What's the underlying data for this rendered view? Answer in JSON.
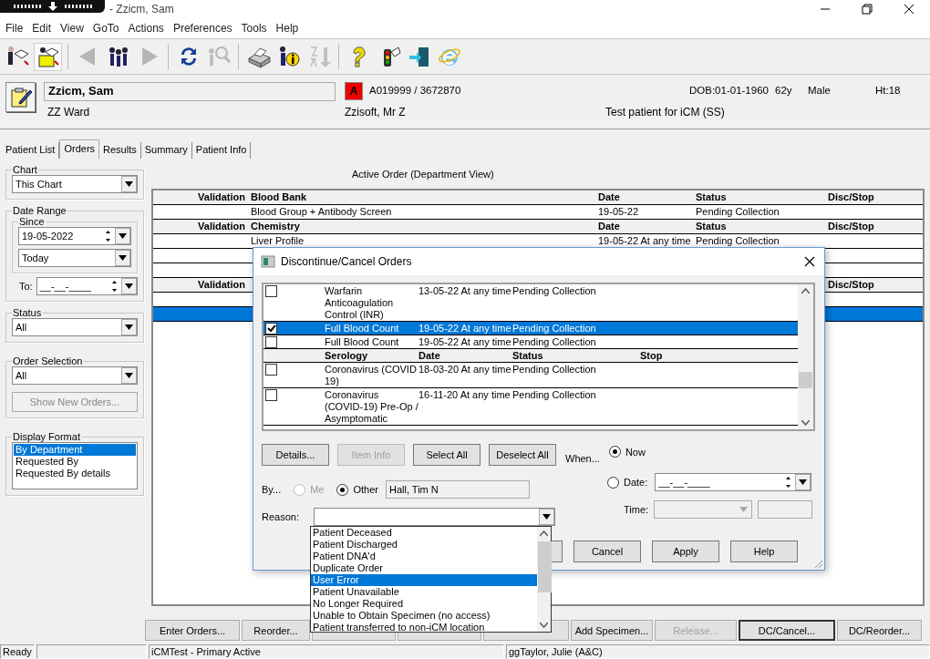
{
  "window": {
    "title": "- Zzicm, Sam"
  },
  "menu": [
    "File",
    "Edit",
    "View",
    "GoTo",
    "Actions",
    "Preferences",
    "Tools",
    "Help"
  ],
  "toolbar": [
    {
      "kind": "button",
      "disabled": false,
      "selected": false
    },
    {
      "kind": "button",
      "disabled": false,
      "selected": true
    },
    {
      "kind": "separator"
    },
    {
      "kind": "button",
      "disabled": true,
      "selected": false
    },
    {
      "kind": "button",
      "disabled": false,
      "selected": false
    },
    {
      "kind": "button",
      "disabled": true,
      "selected": false
    },
    {
      "kind": "separator"
    },
    {
      "kind": "button",
      "disabled": false,
      "selected": false
    },
    {
      "kind": "button",
      "disabled": true,
      "selected": false
    },
    {
      "kind": "separator"
    },
    {
      "kind": "button",
      "disabled": false,
      "selected": false
    },
    {
      "kind": "button",
      "disabled": false,
      "selected": false
    },
    {
      "kind": "button",
      "disabled": true,
      "selected": false
    },
    {
      "kind": "separator"
    },
    {
      "kind": "button",
      "disabled": false,
      "selected": false
    },
    {
      "kind": "button",
      "disabled": false,
      "selected": false
    },
    {
      "kind": "button",
      "disabled": false,
      "selected": false
    },
    {
      "kind": "button",
      "disabled": false,
      "selected": false
    }
  ],
  "patient": {
    "name": "Zzicm, Sam",
    "ward": "ZZ Ward",
    "alert": "A",
    "ids": "A019999 / 3672870",
    "consultant": "Zzisoft, Mr Z",
    "note": "Test patient for iCM (SS)",
    "dob": "DOB:01-01-1960",
    "age": "62y",
    "sex": "Male",
    "height": "Ht:18"
  },
  "tabs": [
    {
      "label": "Patient List",
      "selected": false
    },
    {
      "label": "Orders",
      "selected": true
    },
    {
      "label": "Results",
      "selected": false
    },
    {
      "label": "Summary",
      "selected": false
    },
    {
      "label": "Patient Info",
      "selected": false
    }
  ],
  "filters": {
    "chart": {
      "label": "Chart",
      "value": "This Chart"
    },
    "date_range": {
      "label": "Date Range",
      "since_label": "Since",
      "since_date": "19-05-2022",
      "since_preset": "Today",
      "to_label": "To:",
      "to_date": "__-__-____"
    },
    "status": {
      "label": "Status",
      "value": "All"
    },
    "order_selection": {
      "label": "Order Selection",
      "value": "All",
      "button": {
        "label": "Show New Orders...",
        "disabled": true
      }
    },
    "display_format": {
      "label": "Display Format",
      "items": [
        {
          "label": "By Department",
          "selected": true
        },
        {
          "label": "Requested By",
          "selected": false
        },
        {
          "label": "Requested By details",
          "selected": false
        }
      ]
    }
  },
  "orders": {
    "title": "Active Order (Department View)",
    "rows": [
      {
        "kind": "header",
        "validation": "Validation",
        "name": "Blood Bank",
        "date": "Date",
        "status": "Status",
        "disc": "Disc/Stop"
      },
      {
        "kind": "order",
        "name": "Blood Group + Antibody Screen",
        "date": "19-05-22",
        "status": "Pending Collection",
        "selected": false
      },
      {
        "kind": "header",
        "validation": "Validation",
        "name": "Chemistry",
        "date": "Date",
        "status": "Status",
        "disc": "Disc/Stop"
      },
      {
        "kind": "order",
        "name": "Liver Profile",
        "date": "19-05-22 At any time",
        "status": "Pending Collection",
        "selected": false
      },
      {
        "kind": "order",
        "selected": false
      },
      {
        "kind": "order",
        "selected": false
      },
      {
        "kind": "header",
        "validation": "Validation",
        "disc": "Disc/Stop"
      },
      {
        "kind": "order",
        "selected": false
      },
      {
        "kind": "order",
        "selected": true
      }
    ]
  },
  "actions": [
    {
      "label": "Enter Orders...",
      "disabled": false,
      "default": false
    },
    {
      "label": "Reorder...",
      "disabled": false,
      "default": false
    },
    {
      "default": false
    },
    {
      "default": false
    },
    {
      "default": false
    },
    {
      "label": "Add Specimen...",
      "disabled": false,
      "default": false
    },
    {
      "label": "Release...",
      "disabled": true,
      "default": false
    },
    {
      "label": "DC/Cancel...",
      "disabled": false,
      "default": true
    },
    {
      "label": "DC/Reorder...",
      "disabled": false,
      "default": false
    }
  ],
  "status_bar": {
    "state": "Ready",
    "system": "iCMTest - Primary Active",
    "user": "ggTaylor, Julie  (A&C)"
  },
  "dialog": {
    "title": "Discontinue/Cancel Orders",
    "rows": [
      {
        "kind": "order",
        "checked": false,
        "selected": false,
        "name": "Warfarin Anticoagulation Control (INR)",
        "date": "13-05-22 At any time",
        "status": "Pending Collection"
      },
      {
        "kind": "order",
        "checked": true,
        "selected": true,
        "name": "Full Blood Count",
        "date": "19-05-22 At any time",
        "status": "Pending Collection"
      },
      {
        "kind": "order",
        "checked": false,
        "selected": false,
        "name": "Full Blood Count",
        "date": "19-05-22 At any time",
        "status": "Pending Collection"
      },
      {
        "kind": "header",
        "name": "Serology",
        "date": "Date",
        "status": "Status",
        "stop": "Stop"
      },
      {
        "kind": "order",
        "checked": false,
        "selected": false,
        "name": "Coronavirus (COVID 19)",
        "date": "18-03-20 At any time",
        "status": "Pending Collection"
      },
      {
        "kind": "order",
        "checked": false,
        "selected": false,
        "name": "Coronavirus (COVID-19) Pre-Op / Asymptomatic",
        "date": "16-11-20 At any time",
        "status": "Pending Collection"
      }
    ],
    "buttons": [
      {
        "label": "Details...",
        "disabled": false
      },
      {
        "label": "Item Info",
        "disabled": true
      },
      {
        "label": "Select All",
        "disabled": false
      },
      {
        "label": "Deselect All",
        "disabled": false
      }
    ],
    "when": {
      "label": "When...",
      "now": {
        "label": "Now",
        "selected": true
      },
      "date": {
        "label": "Date:",
        "selected": false
      },
      "date_value": "__-__-____",
      "time_label": "Time:"
    },
    "by": {
      "label": "By...",
      "options": [
        {
          "label": "Me",
          "selected": false,
          "disabled": true
        },
        {
          "label": "Other",
          "selected": true,
          "disabled": false
        }
      ],
      "value": "Hall, Tim N"
    },
    "reason": {
      "label": "Reason:",
      "expanded": true,
      "options": [
        {
          "label": "Patient Deceased",
          "selected": false
        },
        {
          "label": "Patient Discharged",
          "selected": false
        },
        {
          "label": "Patient DNA'd",
          "selected": false
        },
        {
          "label": "Duplicate Order",
          "selected": false
        },
        {
          "label": "User Error",
          "selected": true
        },
        {
          "label": "Patient Unavailable",
          "selected": false
        },
        {
          "label": "No Longer Required",
          "selected": false
        },
        {
          "label": "Unable to Obtain Specimen (no access)",
          "selected": false
        },
        {
          "label": "Patient transferred to non-iCM location",
          "selected": false
        }
      ]
    },
    "footer_buttons": [
      {
        "disabled": false
      },
      {
        "label": "Cancel",
        "disabled": false
      },
      {
        "label": "Apply",
        "disabled": false
      },
      {
        "label": "Help",
        "disabled": false
      }
    ]
  }
}
